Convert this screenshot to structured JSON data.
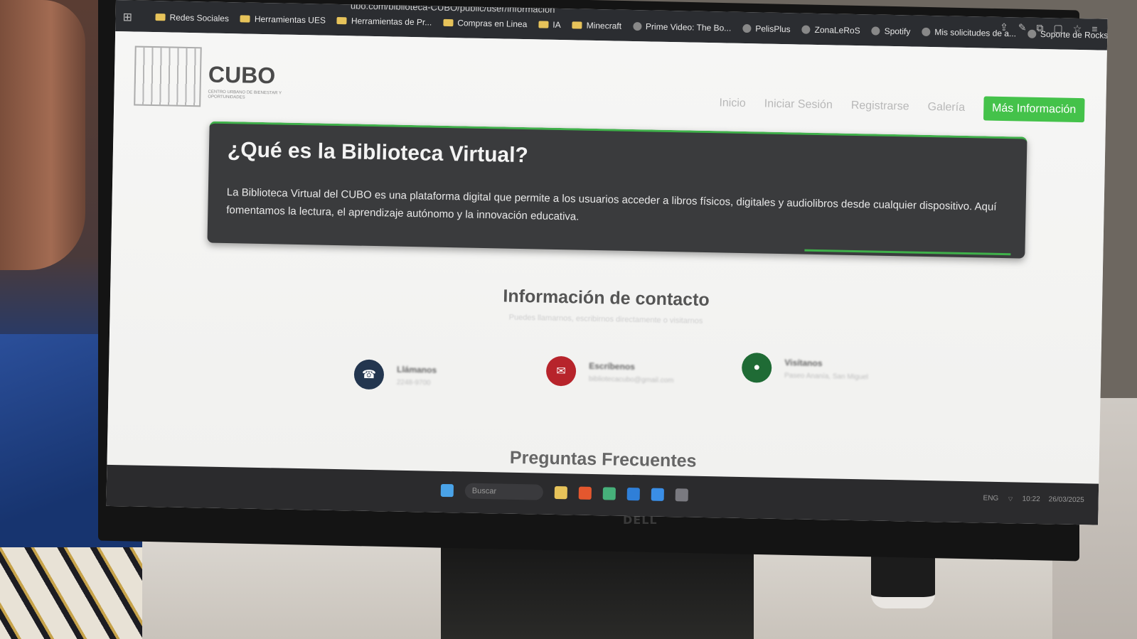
{
  "browser": {
    "url": "ubo.com/biblioteca-CUBO/public/user/informacion",
    "bookmarks": [
      {
        "label": "Redes Sociales",
        "icon": "folder-icon"
      },
      {
        "label": "Herramientas UES",
        "icon": "folder-icon"
      },
      {
        "label": "Herramientas de Pr...",
        "icon": "folder-icon"
      },
      {
        "label": "Compras en Linea",
        "icon": "folder-icon"
      },
      {
        "label": "IA",
        "icon": "folder-icon"
      },
      {
        "label": "Minecraft",
        "icon": "folder-icon"
      },
      {
        "label": "Prime Video: The Bo...",
        "icon": "prime-video-icon"
      },
      {
        "label": "PelisPlus",
        "icon": "pelisplus-icon"
      },
      {
        "label": "ZonaLeRoS",
        "icon": "zonaleros-icon"
      },
      {
        "label": "Spotify",
        "icon": "spotify-icon"
      },
      {
        "label": "Mis solicitudes de a...",
        "icon": "page-icon"
      },
      {
        "label": "Soporte de Rockstar...",
        "icon": "rockstar-icon"
      }
    ]
  },
  "site": {
    "logo": {
      "name": "CUBO",
      "subtitle": "CENTRO URBANO DE BIENESTAR Y OPORTUNIDADES"
    },
    "nav": {
      "home": "Inicio",
      "login": "Iniciar Sesión",
      "register": "Registrarse",
      "gallery": "Galería",
      "more_info": "Más Información"
    },
    "hero": {
      "title": "¿Qué es la Biblioteca Virtual?",
      "text": "La Biblioteca Virtual del CUBO es una plataforma digital que permite a los usuarios acceder a libros físicos, digitales y audiolibros desde cualquier dispositivo. Aquí fomentamos la lectura, el aprendizaje autónomo y la innovación educativa."
    },
    "contact": {
      "title": "Información de contacto",
      "subtitle": "Puedes llamarnos, escribirnos directamente o visitarnos",
      "items": [
        {
          "title": "Llámanos",
          "value": "2248-9700",
          "icon": "phone-icon",
          "color": "#23364f"
        },
        {
          "title": "Escríbenos",
          "value": "bibliotecacubo@gmail.com",
          "icon": "mail-icon",
          "color": "#b7242b"
        },
        {
          "title": "Visítanos",
          "value": "Paseo Ananía, San Miguel",
          "icon": "location-pin-icon",
          "color": "#1f6b35"
        }
      ]
    },
    "faq_title": "Preguntas Frecuentes"
  },
  "taskbar": {
    "search_placeholder": "Buscar",
    "tray": {
      "lang": "ENG",
      "time": "10:22",
      "date": "26/03/2025"
    }
  },
  "monitor_brand": "DELL"
}
